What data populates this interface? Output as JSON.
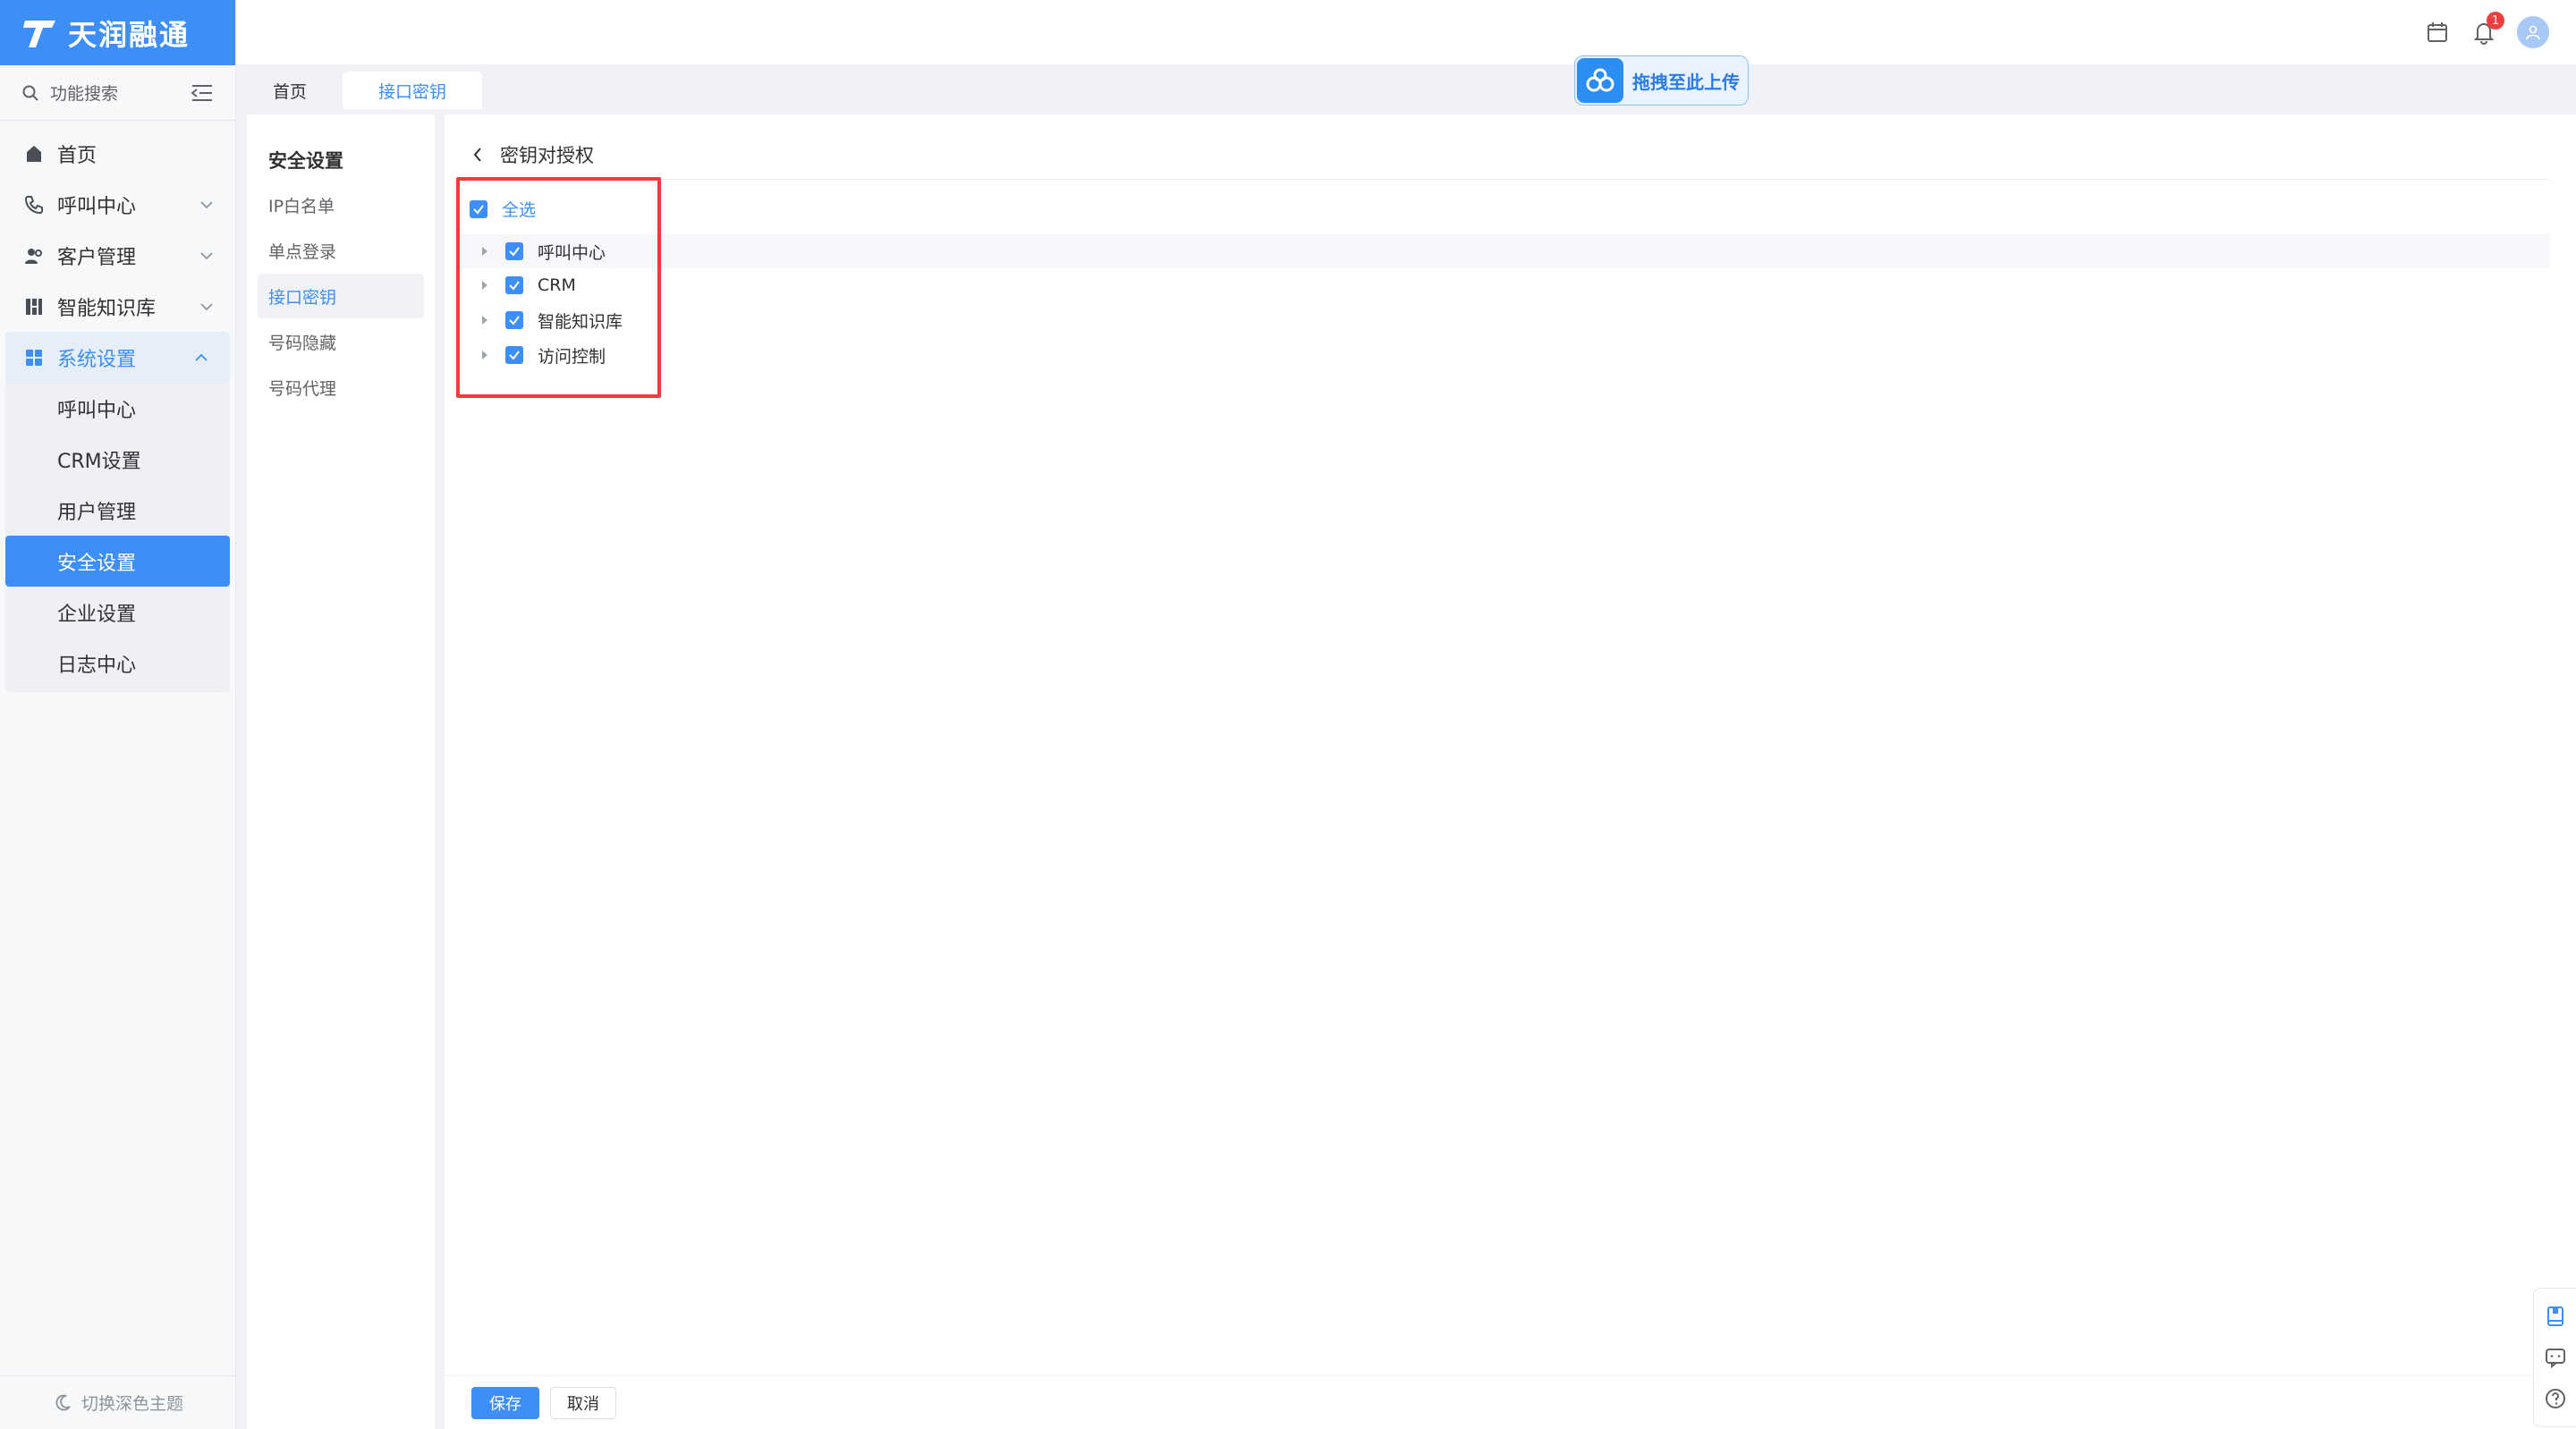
{
  "brand": {
    "name": "天润融通"
  },
  "sidebar": {
    "search_placeholder": "功能搜索",
    "items": [
      {
        "label": "首页",
        "icon": "home-icon"
      },
      {
        "label": "呼叫中心",
        "icon": "phone-icon"
      },
      {
        "label": "客户管理",
        "icon": "users-icon"
      },
      {
        "label": "智能知识库",
        "icon": "knowledge-icon"
      },
      {
        "label": "系统设置",
        "icon": "grid-icon"
      }
    ],
    "sub_items": [
      {
        "label": "呼叫中心"
      },
      {
        "label": "CRM设置"
      },
      {
        "label": "用户管理"
      },
      {
        "label": "安全设置"
      },
      {
        "label": "企业设置"
      },
      {
        "label": "日志中心"
      }
    ],
    "theme_toggle": "切换深色主题"
  },
  "header": {
    "notification_count": "1"
  },
  "tabs": [
    {
      "label": "首页"
    },
    {
      "label": "接口密钥"
    }
  ],
  "upload": {
    "label": "拖拽至此上传"
  },
  "panel": {
    "title": "安全设置",
    "items": [
      {
        "label": "IP白名单"
      },
      {
        "label": "单点登录"
      },
      {
        "label": "接口密钥"
      },
      {
        "label": "号码隐藏"
      },
      {
        "label": "号码代理"
      }
    ]
  },
  "main": {
    "back_title": "密钥对授权",
    "check_all": "全选",
    "tree": [
      {
        "label": "呼叫中心"
      },
      {
        "label": "CRM"
      },
      {
        "label": "智能知识库"
      },
      {
        "label": "访问控制"
      }
    ],
    "save": "保存",
    "cancel": "取消"
  },
  "colors": {
    "primary": "#3d8ff5",
    "highlight_box": "#ef3b3b"
  }
}
